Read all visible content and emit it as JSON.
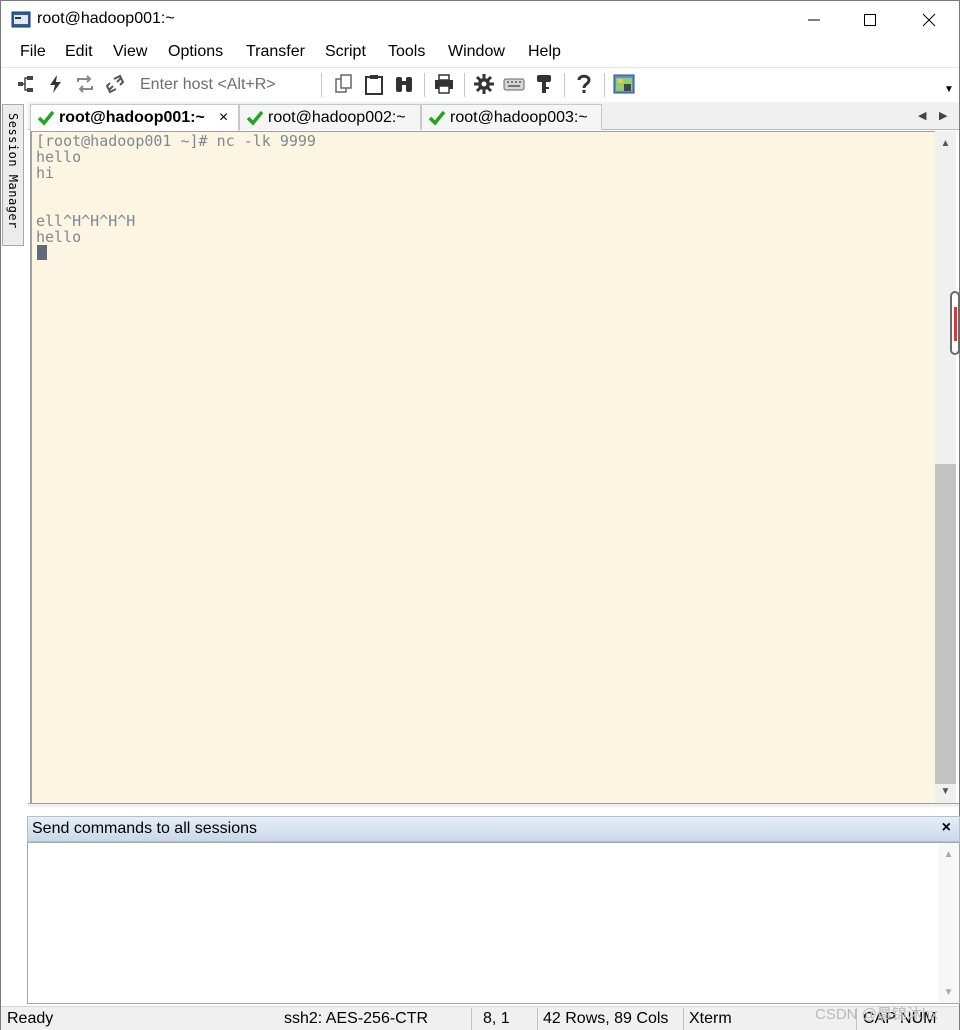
{
  "window": {
    "title": "root@hadoop001:~"
  },
  "menu": [
    "File",
    "Edit",
    "View",
    "Options",
    "Transfer",
    "Script",
    "Tools",
    "Window",
    "Help"
  ],
  "toolbar": {
    "host_placeholder": "Enter host <Alt+R>"
  },
  "side_panel": {
    "label": "Session Manager"
  },
  "tabs": [
    {
      "label": "root@hadoop001:~",
      "active": true,
      "close": "×"
    },
    {
      "label": "root@hadoop002:~",
      "active": false
    },
    {
      "label": "root@hadoop003:~",
      "active": false
    }
  ],
  "terminal": {
    "lines": [
      "[root@hadoop001 ~]# nc -lk 9999",
      "hello",
      "hi",
      "",
      "",
      "ell^H^H^H^H",
      "hello"
    ]
  },
  "command_window": {
    "title": "Send commands to all sessions",
    "close": "×"
  },
  "statusbar": {
    "status": "Ready",
    "cipher": "ssh2: AES-256-CTR",
    "position": "8,  1",
    "size": "42 Rows, 89 Cols",
    "terminal_type": "Xterm",
    "keys": "CAP NUM"
  },
  "watermark": "CSDN @晨锦沐hx",
  "colors": {
    "terminal_bg": "#fcf5e2",
    "terminal_fg": "#7c8a92",
    "check_green": "#1fa81f"
  }
}
